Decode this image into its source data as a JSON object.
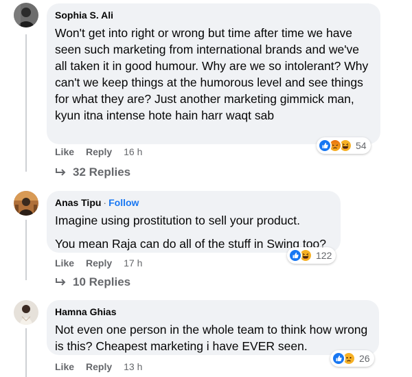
{
  "comments": [
    {
      "author": "Sophia S. Ali",
      "paragraphs": [
        "Won't get into right or wrong but time after time we have seen such marketing from international brands and we've all taken it in good humour. Why are we so intolerant? Why can't we keep things at the humorous level and see things for what they are? Just another marketing gimmick man, kyun itna intense hote hain harr waqt sab"
      ],
      "like_label": "Like",
      "reply_label": "Reply",
      "time": "16 h",
      "reaction_icons": [
        "like-icon",
        "angry-icon",
        "haha-icon"
      ],
      "reaction_count": "54",
      "replies_label": "32 Replies"
    },
    {
      "author": "Anas Tipu",
      "separator": "·",
      "follow_label": "Follow",
      "paragraphs": [
        "Imagine using prostitution to sell your product.",
        "You mean Raja can do all of the stuff in Swing too?"
      ],
      "like_label": "Like",
      "reply_label": "Reply",
      "time": "17 h",
      "reaction_icons": [
        "like-icon",
        "haha-icon"
      ],
      "reaction_count": "122",
      "replies_label": "10 Replies"
    },
    {
      "author": "Hamna Ghias",
      "paragraphs": [
        "Not even one person in the whole team to think how wrong is this? Cheapest marketing i have EVER seen."
      ],
      "like_label": "Like",
      "reply_label": "Reply",
      "time": "13 h",
      "reaction_icons": [
        "like-icon",
        "sad-icon"
      ],
      "reaction_count": "26"
    }
  ],
  "colors": {
    "bubble": "#f0f2f5",
    "meta_text": "#65676b",
    "follow_link": "#1877f2",
    "like_reaction": "#1877f2",
    "angry_reaction": "#e9710f",
    "haha_reaction": "#f7b125"
  }
}
